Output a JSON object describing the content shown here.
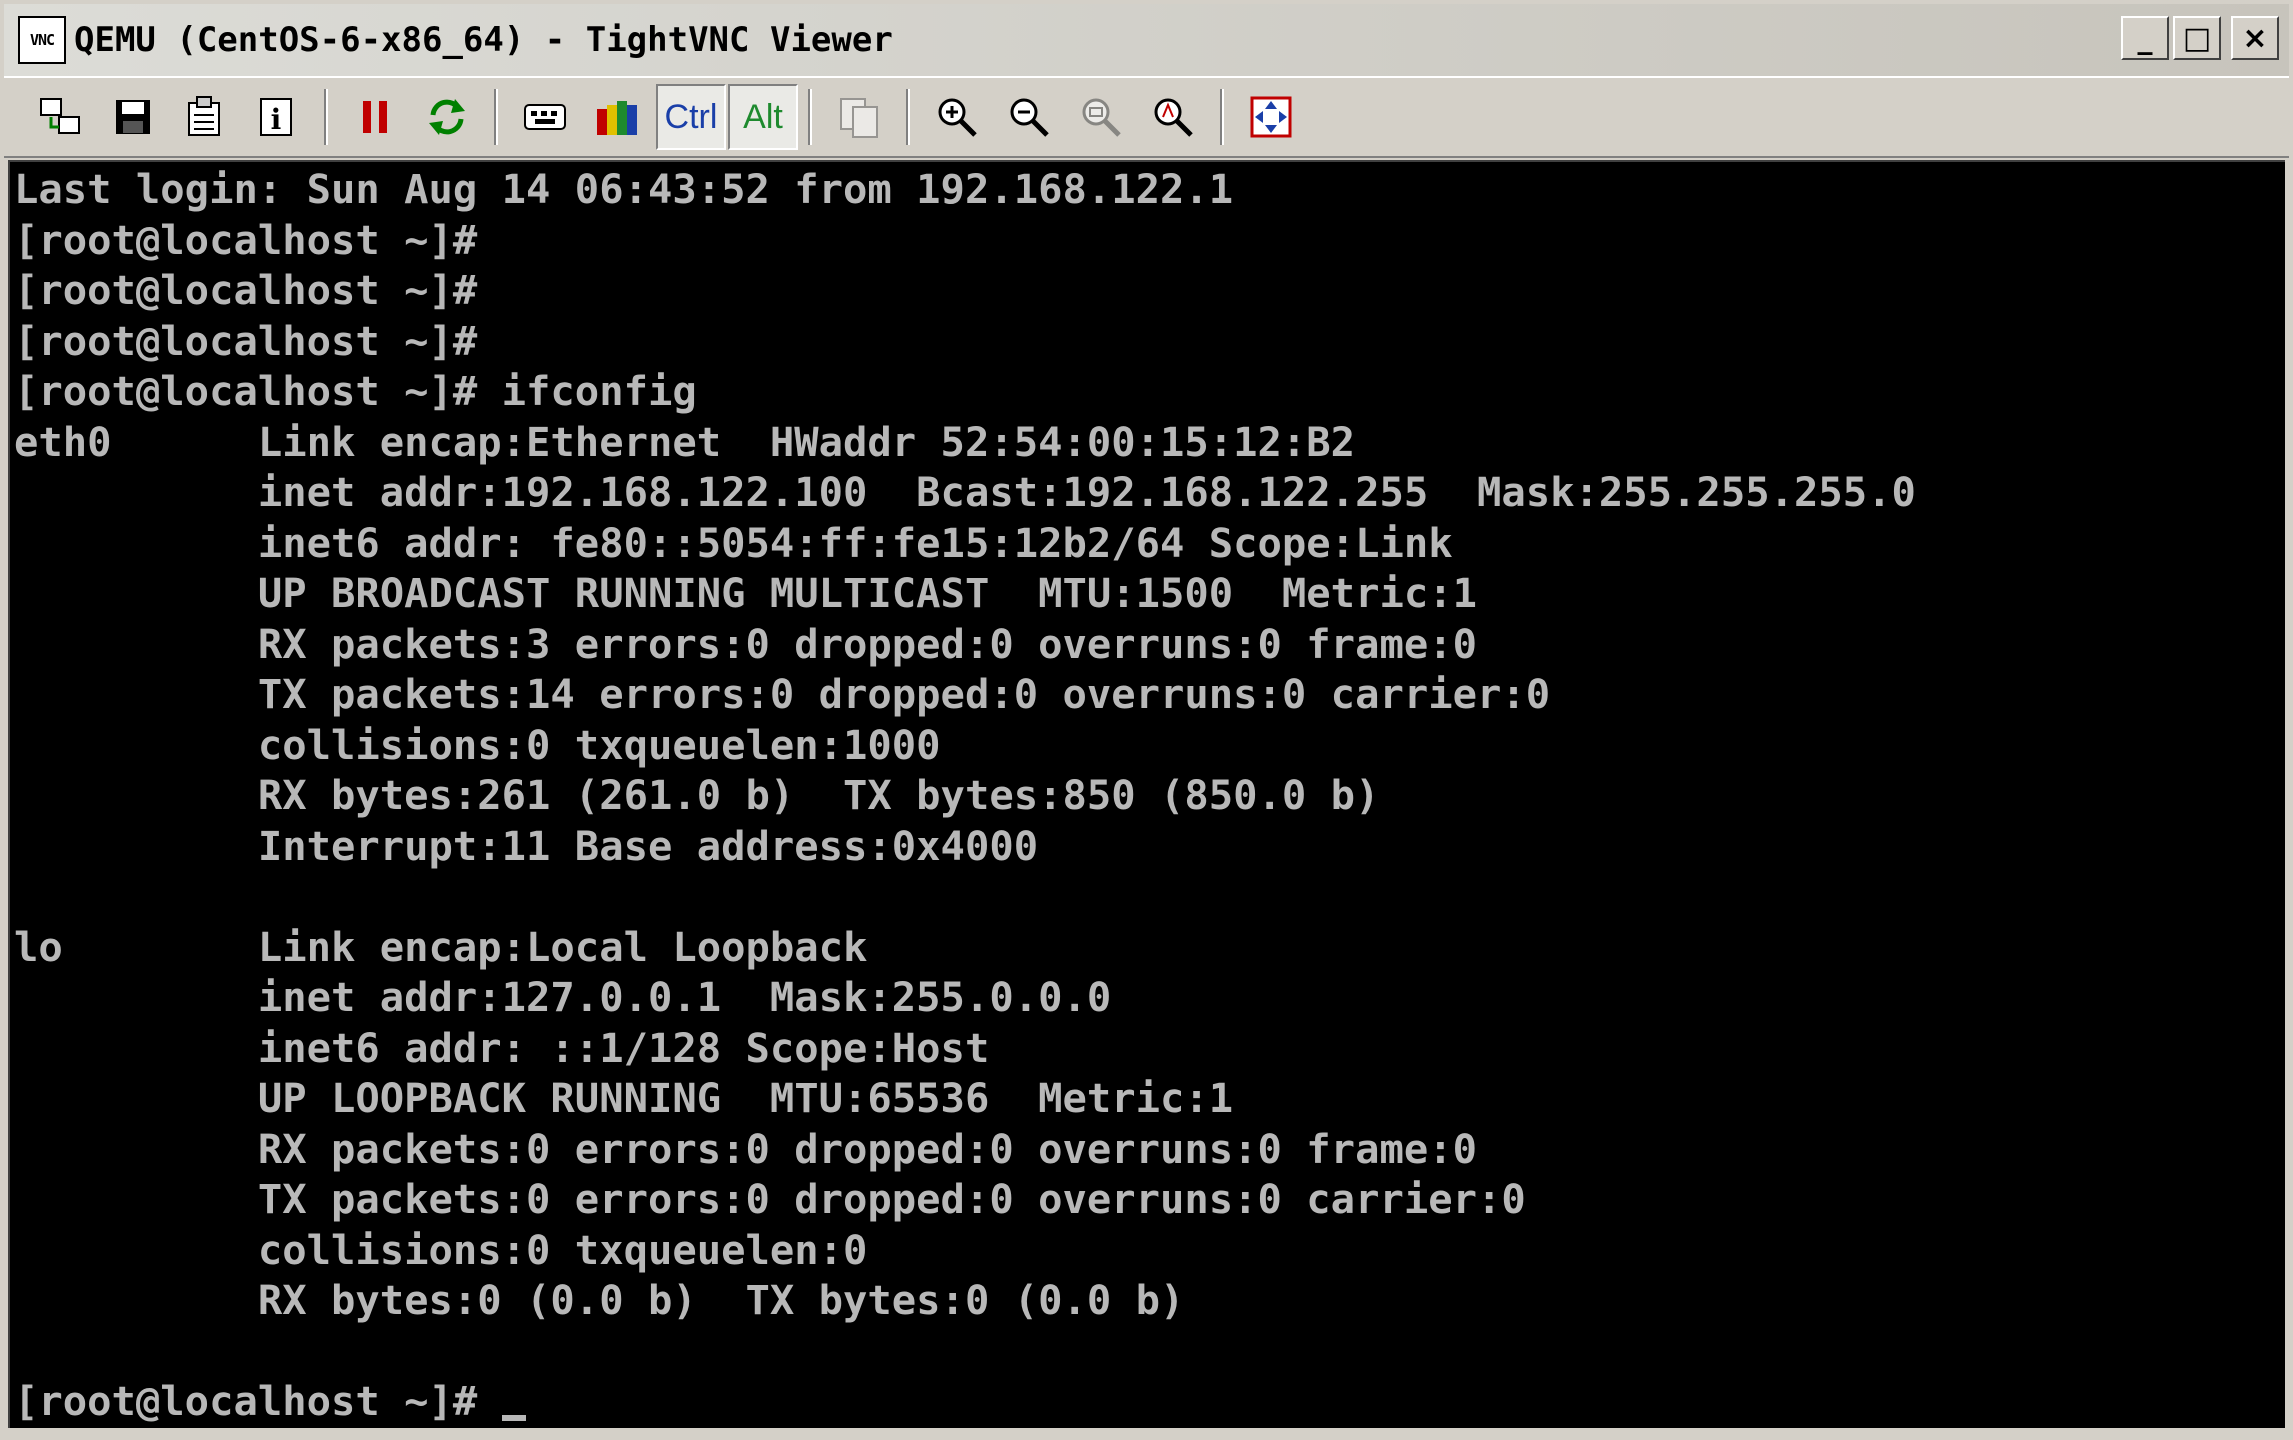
{
  "window": {
    "title": "QEMU (CentOS-6-x86_64) - TightVNC Viewer",
    "icon_text": "VNC",
    "controls": {
      "minimize": "_",
      "maximize": "□",
      "close": "×"
    }
  },
  "toolbar": {
    "ctrl_label": "Ctrl",
    "alt_label": "Alt",
    "icons": [
      "new-connection-icon",
      "save-icon",
      "options-icon",
      "info-icon",
      "pause-icon",
      "refresh-icon",
      "ctrl-alt-del-icon",
      "color-icon",
      "ctrl-toggle",
      "alt-toggle",
      "clipboard-icon",
      "zoom-in-icon",
      "zoom-out-icon",
      "zoom-100-icon",
      "zoom-auto-icon",
      "fullscreen-icon"
    ]
  },
  "terminal": {
    "lines": [
      "Last login: Sun Aug 14 06:43:52 from 192.168.122.1",
      "[root@localhost ~]#",
      "[root@localhost ~]#",
      "[root@localhost ~]#",
      "[root@localhost ~]# ifconfig",
      "eth0      Link encap:Ethernet  HWaddr 52:54:00:15:12:B2",
      "          inet addr:192.168.122.100  Bcast:192.168.122.255  Mask:255.255.255.0",
      "          inet6 addr: fe80::5054:ff:fe15:12b2/64 Scope:Link",
      "          UP BROADCAST RUNNING MULTICAST  MTU:1500  Metric:1",
      "          RX packets:3 errors:0 dropped:0 overruns:0 frame:0",
      "          TX packets:14 errors:0 dropped:0 overruns:0 carrier:0",
      "          collisions:0 txqueuelen:1000",
      "          RX bytes:261 (261.0 b)  TX bytes:850 (850.0 b)",
      "          Interrupt:11 Base address:0x4000",
      "",
      "lo        Link encap:Local Loopback",
      "          inet addr:127.0.0.1  Mask:255.0.0.0",
      "          inet6 addr: ::1/128 Scope:Host",
      "          UP LOOPBACK RUNNING  MTU:65536  Metric:1",
      "          RX packets:0 errors:0 dropped:0 overruns:0 frame:0",
      "          TX packets:0 errors:0 dropped:0 overruns:0 carrier:0",
      "          collisions:0 txqueuelen:0",
      "          RX bytes:0 (0.0 b)  TX bytes:0 (0.0 b)",
      ""
    ],
    "prompt": "[root@localhost ~]# "
  },
  "colors": {
    "terminal_bg": "#000000",
    "terminal_fg": "#b8b8b8",
    "chrome": "#d4d0c8"
  }
}
